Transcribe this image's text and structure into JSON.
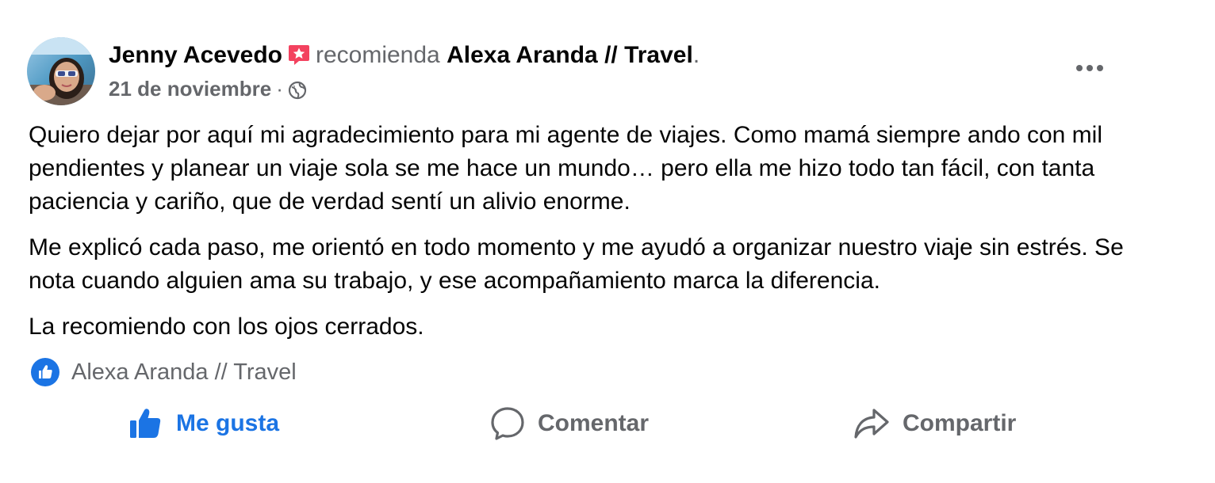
{
  "post": {
    "author_name": "Jenny Acevedo",
    "verb": "recomienda",
    "page_name": "Alexa Aranda // Travel",
    "period": ".",
    "date": "21 de noviembre",
    "separator": "·",
    "privacy_icon": "globe-icon",
    "recommend_icon": "recommendation-star-icon",
    "more_icon": "ellipsis-icon",
    "paragraphs": [
      "Quiero dejar por aquí mi agradecimiento para mi agente de viajes. Como mamá siempre ando con mil pendientes y planear un viaje sola se me hace un mundo… pero ella me hizo todo tan fácil, con tanta paciencia y cariño, que de verdad sentí un alivio enorme.",
      "Me explicó cada paso, me orientó en todo momento y me ayudó a organizar nuestro viaje sin estrés. Se nota cuando alguien ama su trabajo, y ese acompañamiento marca la diferencia.",
      "La recomiendo con los ojos cerrados."
    ]
  },
  "reactions": {
    "icon": "like-reaction-icon",
    "names": "Alexa Aranda // Travel"
  },
  "actions": {
    "like_label": "Me gusta",
    "comment_label": "Comentar",
    "share_label": "Compartir"
  },
  "colors": {
    "like_blue": "#1b74e4",
    "secondary_text": "#65676b",
    "primary_text": "#050505",
    "recommend_red": "#f3425f"
  }
}
